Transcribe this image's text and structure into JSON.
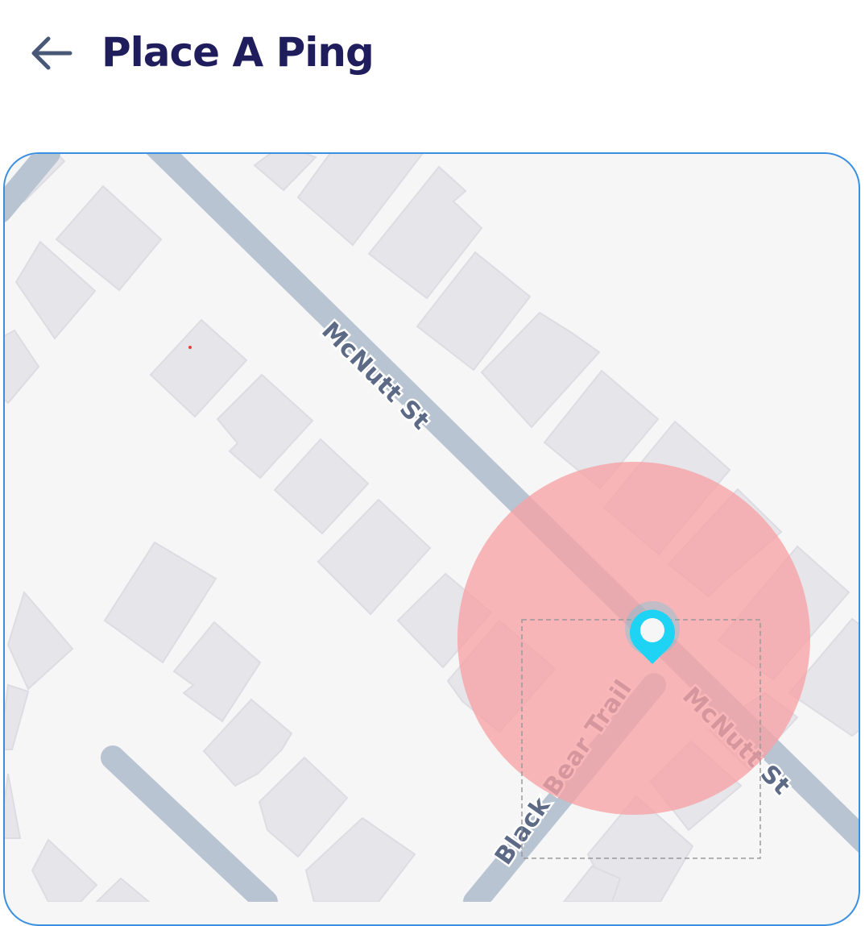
{
  "header": {
    "back_icon": "arrow-left-icon",
    "title": "Place A Ping"
  },
  "map": {
    "streets": [
      {
        "name": "McNutt St"
      },
      {
        "name": "McNutt St"
      },
      {
        "name": "Black Bear Trail"
      }
    ],
    "ping": {
      "pin_icon": "map-pin-icon",
      "pin_color": "#1fd3f5",
      "radius_color": "#f7a3a5"
    },
    "colors": {
      "background": "#f6f6f7",
      "building": "#e5e5ea",
      "road": "#b8c4d2",
      "border": "#3b8fe0"
    }
  }
}
